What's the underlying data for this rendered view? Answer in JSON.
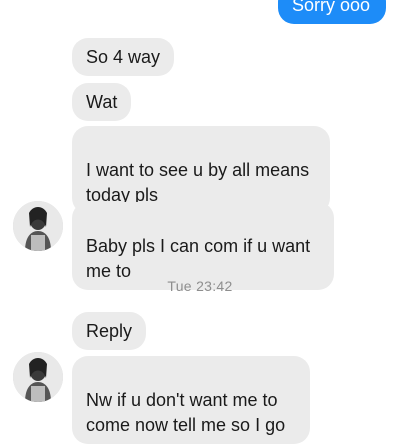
{
  "chat": {
    "outgoing": [
      {
        "text": "Sorry ooo"
      }
    ],
    "incoming": [
      {
        "text": "So 4 way"
      },
      {
        "text": "Wat"
      },
      {
        "text": "I want to see u by all means\ntoday pls"
      },
      {
        "text": "Baby pls I can com if u want\nme to"
      },
      {
        "text": "Reply"
      },
      {
        "text": "Nw if u don't want me to\ncome now tell me so I go"
      }
    ],
    "timestamp": "Tue 23:42",
    "avatar_icon": "contact-profile-photo"
  },
  "colors": {
    "outgoing_bubble": "#1d8cf8",
    "incoming_bubble": "#ebebeb",
    "timestamp_text": "#8e8e8e"
  }
}
